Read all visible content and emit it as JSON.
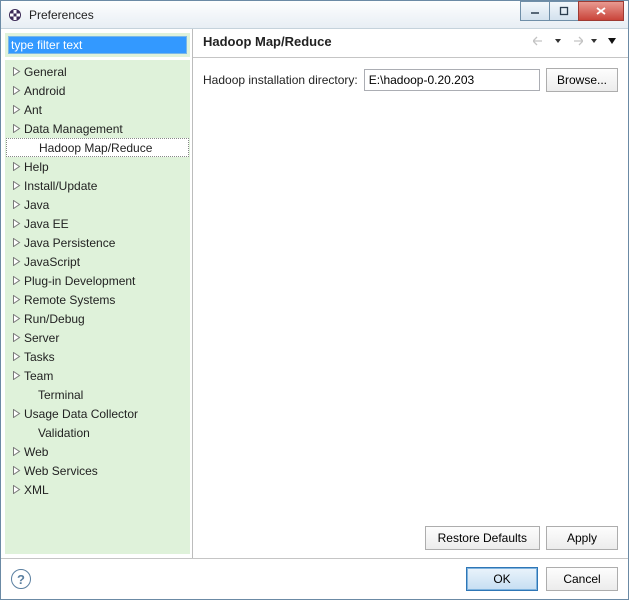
{
  "window": {
    "title": "Preferences"
  },
  "filter": {
    "placeholder": "type filter text",
    "value": "type filter text"
  },
  "tree": {
    "items": [
      {
        "label": "General",
        "depth": 0,
        "expandable": true,
        "selected": false
      },
      {
        "label": "Android",
        "depth": 0,
        "expandable": true,
        "selected": false
      },
      {
        "label": "Ant",
        "depth": 0,
        "expandable": true,
        "selected": false
      },
      {
        "label": "Data Management",
        "depth": 0,
        "expandable": true,
        "selected": false
      },
      {
        "label": "Hadoop Map/Reduce",
        "depth": 1,
        "expandable": false,
        "selected": true
      },
      {
        "label": "Help",
        "depth": 0,
        "expandable": true,
        "selected": false
      },
      {
        "label": "Install/Update",
        "depth": 0,
        "expandable": true,
        "selected": false
      },
      {
        "label": "Java",
        "depth": 0,
        "expandable": true,
        "selected": false
      },
      {
        "label": "Java EE",
        "depth": 0,
        "expandable": true,
        "selected": false
      },
      {
        "label": "Java Persistence",
        "depth": 0,
        "expandable": true,
        "selected": false
      },
      {
        "label": "JavaScript",
        "depth": 0,
        "expandable": true,
        "selected": false
      },
      {
        "label": "Plug-in Development",
        "depth": 0,
        "expandable": true,
        "selected": false
      },
      {
        "label": "Remote Systems",
        "depth": 0,
        "expandable": true,
        "selected": false
      },
      {
        "label": "Run/Debug",
        "depth": 0,
        "expandable": true,
        "selected": false
      },
      {
        "label": "Server",
        "depth": 0,
        "expandable": true,
        "selected": false
      },
      {
        "label": "Tasks",
        "depth": 0,
        "expandable": true,
        "selected": false
      },
      {
        "label": "Team",
        "depth": 0,
        "expandable": true,
        "selected": false
      },
      {
        "label": "Terminal",
        "depth": 1,
        "expandable": false,
        "selected": false
      },
      {
        "label": "Usage Data Collector",
        "depth": 0,
        "expandable": true,
        "selected": false
      },
      {
        "label": "Validation",
        "depth": 1,
        "expandable": false,
        "selected": false
      },
      {
        "label": "Web",
        "depth": 0,
        "expandable": true,
        "selected": false
      },
      {
        "label": "Web Services",
        "depth": 0,
        "expandable": true,
        "selected": false
      },
      {
        "label": "XML",
        "depth": 0,
        "expandable": true,
        "selected": false
      }
    ]
  },
  "page": {
    "title": "Hadoop Map/Reduce",
    "install_dir_label": "Hadoop installation directory:",
    "install_dir_value": "E:\\hadoop-0.20.203",
    "browse_label": "Browse...",
    "restore_label": "Restore Defaults",
    "apply_label": "Apply"
  },
  "footer": {
    "ok_label": "OK",
    "cancel_label": "Cancel"
  }
}
